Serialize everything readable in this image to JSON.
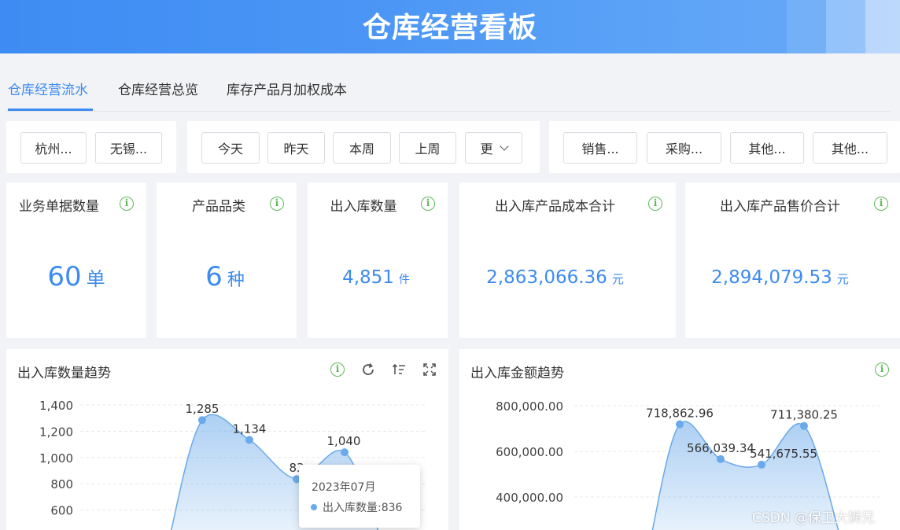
{
  "header": {
    "title": "仓库经营看板"
  },
  "tabs": [
    {
      "label": "仓库经营流水",
      "active": true
    },
    {
      "label": "仓库经营总览",
      "active": false
    },
    {
      "label": "库存产品月加权成本",
      "active": false
    }
  ],
  "filters": {
    "warehouses": [
      "杭州...",
      "无锡..."
    ],
    "periods": [
      "今天",
      "昨天",
      "本周",
      "上周"
    ],
    "more_label": "更",
    "types": [
      "销售...",
      "采购...",
      "其他...",
      "其他..."
    ]
  },
  "stats": [
    {
      "label": "业务单据数量",
      "value": "60",
      "unit": "单"
    },
    {
      "label": "产品品类",
      "value": "6",
      "unit": "种"
    },
    {
      "label": "出入库数量",
      "value": "4,851",
      "unit": "件"
    },
    {
      "label": "出入库产品成本合计",
      "value": "2,863,066.36",
      "unit": "元"
    },
    {
      "label": "出入库产品售价合计",
      "value": "2,894,079.53",
      "unit": "元"
    }
  ],
  "info_glyph": "i",
  "charts": {
    "qty": {
      "title": "出入库数量趋势"
    },
    "amount": {
      "title": "出入库金额趋势"
    }
  },
  "chart_data": [
    {
      "type": "area",
      "title": "出入库数量趋势",
      "y_ticks": [
        "1,400",
        "1,200",
        "1,000",
        "800",
        "600"
      ],
      "ylim": [
        600,
        1400
      ],
      "points": [
        {
          "value": 1285,
          "label": "1,285"
        },
        {
          "value": 1134,
          "label": "1,134"
        },
        {
          "value": 836,
          "label": "83"
        },
        {
          "value": 1040,
          "label": "1,040"
        }
      ],
      "color": "#6aa9ea"
    },
    {
      "type": "area",
      "title": "出入库金额趋势",
      "y_ticks": [
        "800,000.00",
        "600,000.00",
        "400,000.00"
      ],
      "ylim": [
        400000,
        800000
      ],
      "points": [
        {
          "value": 718862.96,
          "label": "718,862.96"
        },
        {
          "value": 566039.34,
          "label": "566,039.34"
        },
        {
          "value": 541675.55,
          "label": "541,675.55"
        },
        {
          "value": 711380.25,
          "label": "711,380.25"
        }
      ],
      "color": "#6aa9ea"
    }
  ],
  "tooltip": {
    "title": "2023年07月",
    "text": "出入库数量:836"
  },
  "watermark": "CSDN @保卫大狮兄",
  "colors": {
    "accent": "#3d8bf2",
    "info": "#5fb85a",
    "series": "#6aa9ea"
  }
}
